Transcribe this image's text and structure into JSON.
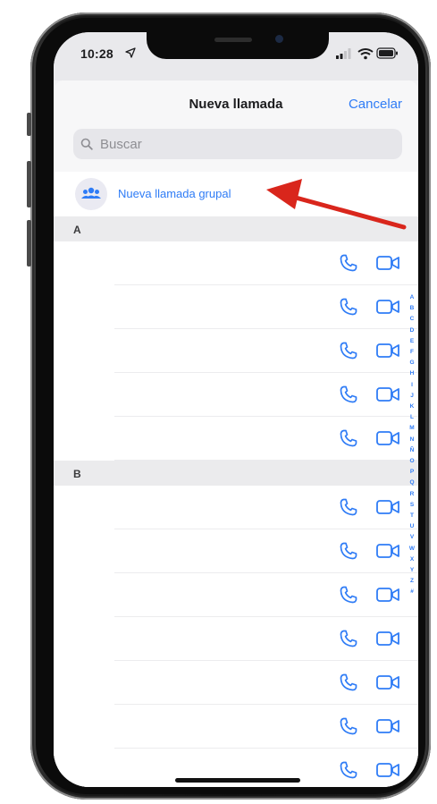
{
  "status_bar": {
    "time": "10:28"
  },
  "nav": {
    "title": "Nueva llamada",
    "cancel_label": "Cancelar"
  },
  "search": {
    "placeholder": "Buscar"
  },
  "group_call": {
    "label": "Nueva llamada grupal",
    "icon": "people-icon"
  },
  "sections": [
    {
      "letter": "A",
      "rows": 5
    },
    {
      "letter": "B",
      "rows": 7
    }
  ],
  "row_actions": {
    "phone_icon": "phone-icon",
    "video_icon": "video-camera-icon"
  },
  "index_letters": [
    "A",
    "B",
    "C",
    "D",
    "E",
    "F",
    "G",
    "H",
    "I",
    "J",
    "K",
    "L",
    "M",
    "N",
    "Ñ",
    "O",
    "P",
    "Q",
    "R",
    "S",
    "T",
    "U",
    "V",
    "W",
    "X",
    "Y",
    "Z",
    "#"
  ],
  "colors": {
    "accent": "#2f7cf6",
    "annotation_arrow": "#d9261c",
    "section_header_bg": "#ebebed"
  }
}
